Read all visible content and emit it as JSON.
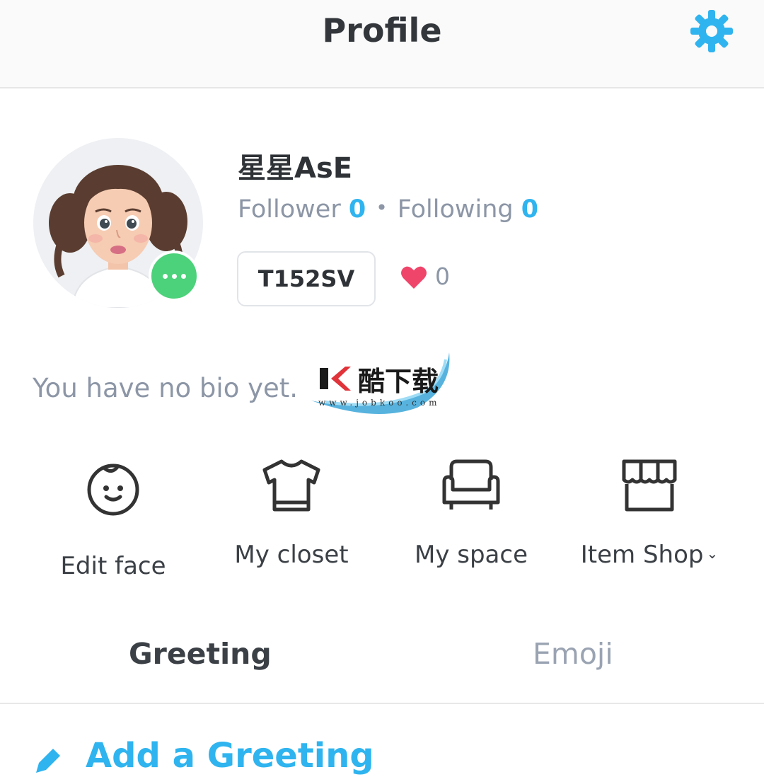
{
  "header": {
    "title": "Profile",
    "settings_icon": "gear-icon"
  },
  "profile": {
    "username": "星星AsE",
    "follower_label": "Follower",
    "follower_count": "0",
    "separator": "•",
    "following_label": "Following",
    "following_count": "0",
    "code": "T152SV",
    "likes": "0",
    "bio": "You have no bio yet."
  },
  "watermark": {
    "text": "酷下载",
    "url": "www.jobkoo.com"
  },
  "actions": [
    {
      "label": "Edit face",
      "icon": "face-icon"
    },
    {
      "label": "My closet",
      "icon": "tshirt-icon"
    },
    {
      "label": "My space",
      "icon": "sofa-icon"
    },
    {
      "label": "Item Shop",
      "icon": "shop-icon"
    }
  ],
  "tabs": [
    {
      "label": "Greeting",
      "active": true
    },
    {
      "label": "Emoji",
      "active": false
    }
  ],
  "greeting": {
    "add_label": "Add a Greeting"
  },
  "colors": {
    "accent": "#2fb4ef",
    "online": "#4cd27a",
    "heart": "#f0456b",
    "muted": "#8c96a6"
  }
}
